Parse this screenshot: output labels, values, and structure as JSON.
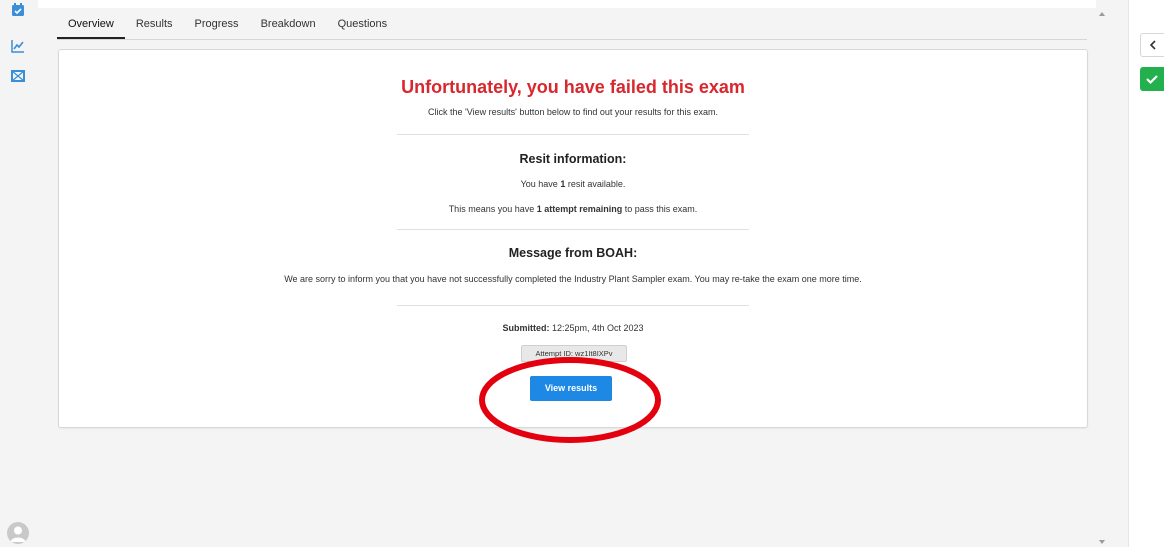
{
  "tabs": [
    {
      "label": "Overview",
      "active": true
    },
    {
      "label": "Results",
      "active": false
    },
    {
      "label": "Progress",
      "active": false
    },
    {
      "label": "Breakdown",
      "active": false
    },
    {
      "label": "Questions",
      "active": false
    }
  ],
  "result": {
    "title": "Unfortunately, you have failed this exam",
    "subtitle": "Click the 'View results' button below to find out your results for this exam."
  },
  "resit": {
    "heading": "Resit information:",
    "line1_pre": "You have ",
    "line1_bold": "1",
    "line1_post": " resit available.",
    "line2_pre": "This means you have ",
    "line2_bold": "1 attempt remaining",
    "line2_post": " to pass this exam."
  },
  "message": {
    "heading": "Message from BOAH:",
    "body": "We are sorry to inform you that you have not successfully completed the Industry Plant Sampler exam.  You may re-take the exam one more time."
  },
  "submission": {
    "label": "Submitted:",
    "value": " 12:25pm, 4th Oct 2023",
    "attempt_id": "Attempt ID: wz1It8IXPv"
  },
  "actions": {
    "view_results": "View results"
  },
  "icons": {
    "rail": [
      "calendar-check-icon",
      "chart-line-icon",
      "image-frame-icon"
    ],
    "right": [
      "chevron-left-icon",
      "check-icon"
    ]
  },
  "colors": {
    "accent_blue": "#1e88e5",
    "fail_red": "#d9272e",
    "success_green": "#23b14d",
    "annotation_red": "#e3000f"
  }
}
